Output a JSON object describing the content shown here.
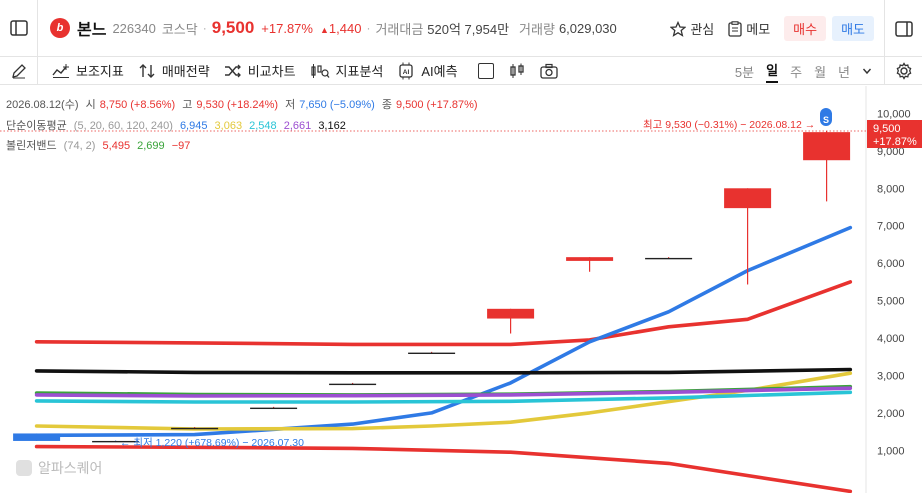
{
  "header": {
    "stock_name": "본느",
    "stock_code": "226340",
    "market": "코스닥",
    "price": "9,500",
    "change_pct": "+17.87%",
    "change_abs": "1,440",
    "trade_amount_label": "거래대금",
    "trade_amount": "520억 7,954만",
    "volume_label": "거래량",
    "volume": "6,029,030",
    "watch_label": "관심",
    "memo_label": "메모",
    "buy_label": "매수",
    "sell_label": "매도"
  },
  "toolbar": {
    "indicator_label": "보조지표",
    "strategy_label": "매매전략",
    "compare_label": "비교차트",
    "analysis_label": "지표분석",
    "ai_label": "AI예측",
    "periods": [
      "5분",
      "일",
      "주",
      "월",
      "년"
    ],
    "active_period": "일"
  },
  "legend": {
    "date": "2026.08.12(수)",
    "open_label": "시",
    "open": "8,750 (+8.56%)",
    "high_label": "고",
    "high": "9,530 (+18.24%)",
    "low_label": "저",
    "low": "7,650 (−5.09%)",
    "close_label": "종",
    "close": "9,500 (+17.87%)",
    "ma_label": "단순이동평균",
    "ma_params": "(5, 20, 60, 120, 240)",
    "ma_values": [
      "6,945",
      "3,063",
      "2,548",
      "2,661",
      "3,162"
    ],
    "bb_label": "볼린저밴드",
    "bb_params": "(74, 2)",
    "bb_values": [
      "5,495",
      "2,699",
      "−97"
    ]
  },
  "annotations": {
    "high_note": "최고 9,530 (−0.31%) − 2026.08.12 →",
    "low_note": "← 최저 1,220 (+678.69%) − 2026.07.30",
    "price_tag": "9,500",
    "price_tag_pct": "+17.87%",
    "marker": "S"
  },
  "watermark": "알파스퀘어",
  "colors": {
    "up": "#e8322f",
    "down": "#2f7ae5",
    "ma5": "#2f7ae5",
    "ma20": "#e3c93b",
    "ma60": "#29c4d6",
    "ma120": "#9c4fd1",
    "ma240": "#111111",
    "bb_upper": "#e8322f",
    "bb_mid": "#3aa33a",
    "bb_lower": "#e8322f"
  },
  "chart_data": {
    "type": "candlestick",
    "yticks": [
      1000,
      2000,
      3000,
      4000,
      5000,
      6000,
      7000,
      8000,
      9000,
      10000
    ],
    "ytick_labels": [
      "1,000",
      "2,000",
      "3,000",
      "4,000",
      "5,000",
      "6,000",
      "7,000",
      "8,000",
      "9,000",
      "10,000"
    ],
    "ylim": [
      0,
      10500
    ],
    "candles": [
      {
        "o": 1450,
        "h": 1450,
        "l": 1250,
        "c": 1250
      },
      {
        "o": 1250,
        "h": 1260,
        "l": 1220,
        "c": 1240
      },
      {
        "o": 1600,
        "h": 1620,
        "l": 1580,
        "c": 1600
      },
      {
        "o": 2140,
        "h": 2160,
        "l": 2120,
        "c": 2140
      },
      {
        "o": 2780,
        "h": 2800,
        "l": 2760,
        "c": 2780
      },
      {
        "o": 3610,
        "h": 3630,
        "l": 3590,
        "c": 3610
      },
      {
        "o": 4520,
        "h": 4780,
        "l": 4120,
        "c": 4780
      },
      {
        "o": 6060,
        "h": 6160,
        "l": 5770,
        "c": 6160
      },
      {
        "o": 6140,
        "h": 6160,
        "l": 6120,
        "c": 6140
      },
      {
        "o": 7470,
        "h": 8000,
        "l": 5430,
        "c": 8000
      },
      {
        "o": 8750,
        "h": 9530,
        "l": 7650,
        "c": 9500
      }
    ],
    "series": [
      {
        "key": "bb_upper",
        "x": [
          0,
          2,
          4,
          6,
          7,
          8,
          9,
          10.3
        ],
        "y": [
          3900,
          3870,
          3830,
          3830,
          3950,
          4300,
          4500,
          5500
        ]
      },
      {
        "key": "ma5",
        "x": [
          0,
          2,
          4,
          5,
          6,
          7,
          8,
          9,
          10.3
        ],
        "y": [
          1400,
          1420,
          1700,
          2000,
          2800,
          3900,
          4700,
          5800,
          6950
        ]
      },
      {
        "key": "ma240",
        "x": [
          0,
          2,
          4,
          6,
          8,
          10.3
        ],
        "y": [
          3120,
          3080,
          3070,
          3070,
          3080,
          3160
        ]
      },
      {
        "key": "ma20",
        "x": [
          0,
          2,
          4,
          5,
          6,
          7,
          8,
          9,
          10.3
        ],
        "y": [
          1650,
          1570,
          1580,
          1650,
          1750,
          2000,
          2300,
          2600,
          3060
        ]
      },
      {
        "key": "bb_mid",
        "x": [
          0,
          2,
          4,
          6,
          8,
          10.3
        ],
        "y": [
          2530,
          2490,
          2480,
          2500,
          2570,
          2700
        ]
      },
      {
        "key": "ma120",
        "x": [
          0,
          2,
          4,
          6,
          8,
          10.3
        ],
        "y": [
          2480,
          2450,
          2460,
          2480,
          2550,
          2660
        ]
      },
      {
        "key": "ma60",
        "x": [
          0,
          2,
          4,
          6,
          8,
          10.3
        ],
        "y": [
          2320,
          2290,
          2290,
          2310,
          2400,
          2550
        ]
      },
      {
        "key": "bb_lower",
        "x": [
          0,
          2,
          4,
          6,
          8,
          10.3
        ],
        "y": [
          1100,
          1080,
          1050,
          950,
          650,
          -97
        ]
      }
    ]
  }
}
